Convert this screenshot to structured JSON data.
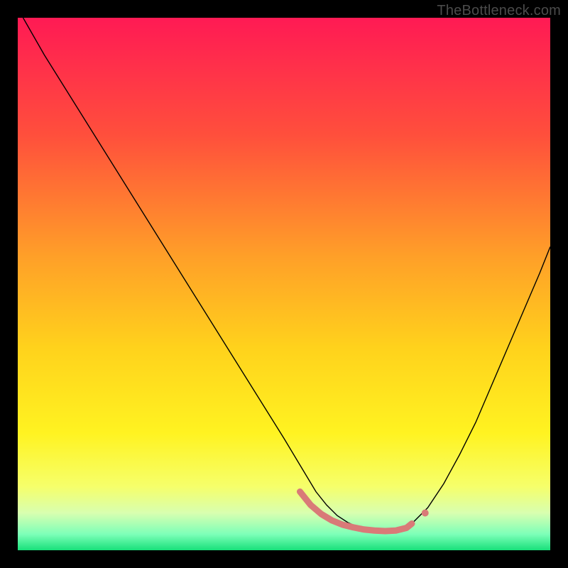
{
  "watermark": "TheBottleneck.com",
  "chart_data": {
    "type": "line",
    "title": "",
    "xlabel": "",
    "ylabel": "",
    "xlim": [
      0,
      100
    ],
    "ylim": [
      0,
      100
    ],
    "grid": false,
    "legend": false,
    "background_gradient": {
      "stops": [
        {
          "offset": 0.0,
          "color": "#ff1a54"
        },
        {
          "offset": 0.22,
          "color": "#ff4f3c"
        },
        {
          "offset": 0.45,
          "color": "#ffa028"
        },
        {
          "offset": 0.62,
          "color": "#ffd21c"
        },
        {
          "offset": 0.78,
          "color": "#fff321"
        },
        {
          "offset": 0.88,
          "color": "#f6ff6a"
        },
        {
          "offset": 0.93,
          "color": "#d8ffb0"
        },
        {
          "offset": 0.97,
          "color": "#7dffb8"
        },
        {
          "offset": 1.0,
          "color": "#18e07a"
        }
      ]
    },
    "series": [
      {
        "name": "bottleneck-curve",
        "color": "#000000",
        "width": 1.4,
        "x": [
          1,
          5,
          10,
          15,
          20,
          25,
          30,
          35,
          40,
          45,
          50,
          53,
          56,
          58,
          60,
          62,
          64,
          66,
          68,
          70,
          72,
          74,
          77,
          80,
          83,
          86,
          89,
          92,
          95,
          98,
          100
        ],
        "y": [
          100,
          93,
          85,
          77,
          69,
          61,
          53,
          45,
          37,
          29,
          21,
          16,
          11,
          8.5,
          6.5,
          5.2,
          4.3,
          3.8,
          3.6,
          3.6,
          4.0,
          5.0,
          8.0,
          12.5,
          18,
          24,
          31,
          38,
          45,
          52,
          57
        ]
      },
      {
        "name": "highlight-band",
        "color": "#d97a78",
        "width": 9,
        "linecap": "round",
        "x": [
          53,
          55,
          57,
          59,
          61,
          63,
          65,
          67,
          69,
          71,
          73,
          74
        ],
        "y": [
          11,
          8.5,
          6.8,
          5.6,
          4.8,
          4.3,
          3.9,
          3.7,
          3.6,
          3.7,
          4.2,
          5.0
        ]
      }
    ],
    "markers": [
      {
        "name": "highlight-dot",
        "x": 76.5,
        "y": 7.0,
        "r": 5,
        "color": "#d97a78"
      }
    ]
  }
}
